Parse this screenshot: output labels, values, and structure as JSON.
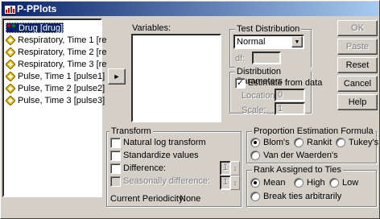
{
  "window": {
    "title": "P-PPlots"
  },
  "source_variables": [
    "Drug [drug]",
    "Respiratory, Time 1 [re",
    "Respiratory, Time 2 [re",
    "Respiratory, Time 3 [re",
    "Pulse, Time 1 [pulse1]",
    "Pulse, Time 2 [pulse2]",
    "Pulse, Time 3 [pulse3]"
  ],
  "variables": {
    "label": "Variables:"
  },
  "move_button": {
    "arrow": "►"
  },
  "test_distribution": {
    "title": "Test Distribution",
    "selected": "Normal",
    "df_label": "df:",
    "df_value": ""
  },
  "distribution_parameters": {
    "title": "Distribution Parameters",
    "estimate_label": "Estimate from data",
    "estimate_checked": true,
    "location_label": "Location:",
    "location_value": "0",
    "scale_label": "Scale:",
    "scale_value": "1"
  },
  "buttons": {
    "ok": "OK",
    "paste": "Paste",
    "reset": "Reset",
    "cancel": "Cancel",
    "help": "Help"
  },
  "transform": {
    "title": "Transform",
    "natural_log": "Natural log transform",
    "standardize": "Standardize values",
    "difference": "Difference:",
    "difference_value": "1",
    "seasonal_difference": "Seasonally difference:",
    "seasonal_value": "1",
    "current_periodicity_label": "Current Periodicity:",
    "current_periodicity_value": "None"
  },
  "proportion_estimation": {
    "title": "Proportion Estimation Formula",
    "options": [
      "Blom's",
      "Rankit",
      "Tukey's",
      "Van der Waerden's"
    ],
    "selected": "Blom's"
  },
  "rank_ties": {
    "title": "Rank Assigned to Ties",
    "options": [
      "Mean",
      "High",
      "Low",
      "Break ties arbitrarily"
    ],
    "selected": "Mean"
  }
}
